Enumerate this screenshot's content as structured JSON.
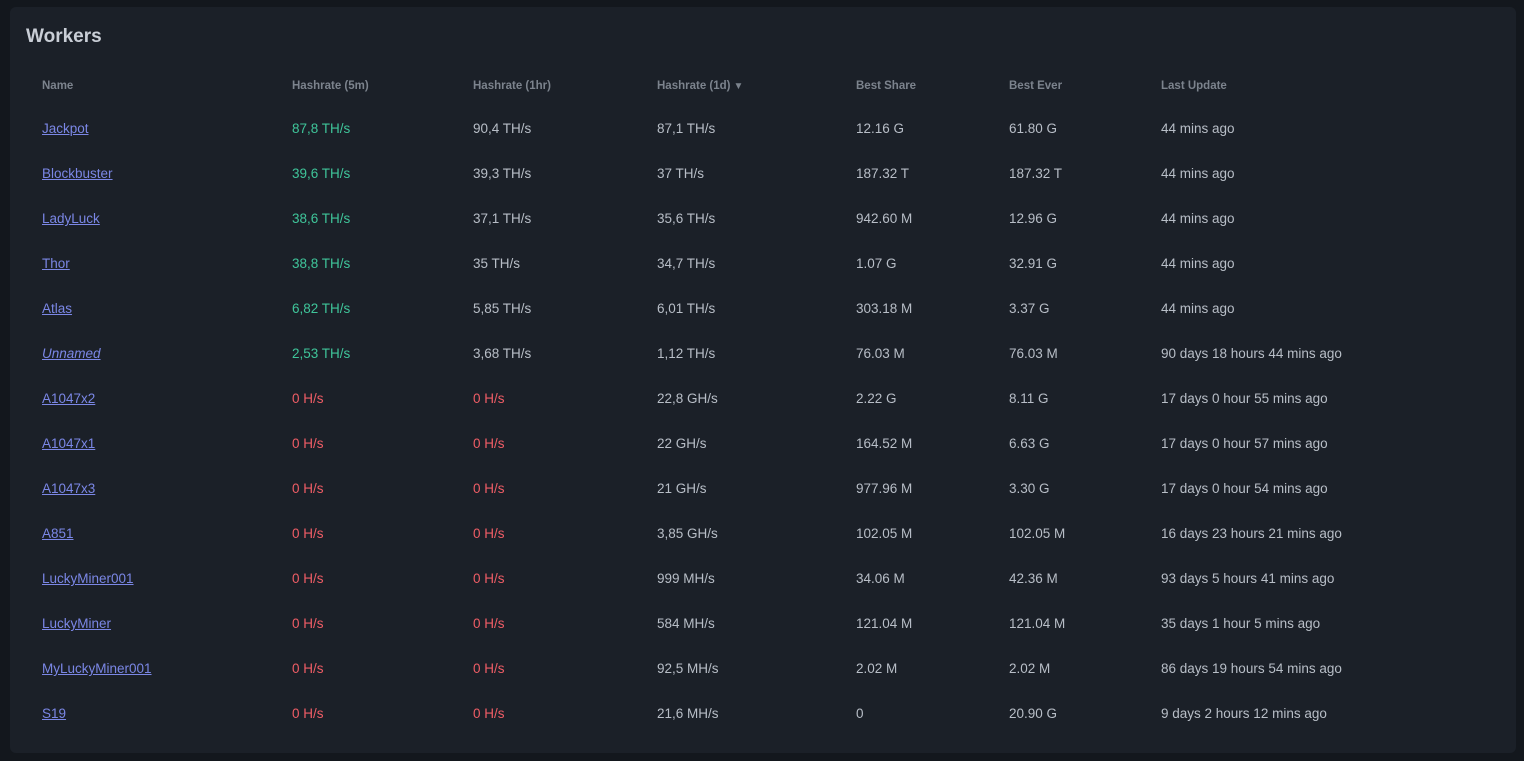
{
  "title": "Workers",
  "columns": {
    "name": "Name",
    "hr5m": "Hashrate (5m)",
    "hr1h": "Hashrate (1hr)",
    "hr1d": "Hashrate (1d)",
    "best_share": "Best Share",
    "best_ever": "Best Ever",
    "last_update": "Last Update"
  },
  "sort_indicator": "▼",
  "colors": {
    "online": "#3fc59a",
    "offline": "#f05d66",
    "link": "#7b87e6"
  },
  "rows": [
    {
      "name": "Jackpot",
      "hr5m": "87,8 TH/s",
      "hr1h": "90,4 TH/s",
      "hr1d": "87,1 TH/s",
      "best_share": "12.16 G",
      "best_ever": "61.80 G",
      "last_update": "44 mins ago",
      "status": "online"
    },
    {
      "name": "Blockbuster",
      "hr5m": "39,6 TH/s",
      "hr1h": "39,3 TH/s",
      "hr1d": "37 TH/s",
      "best_share": "187.32 T",
      "best_ever": "187.32 T",
      "last_update": "44 mins ago",
      "status": "online"
    },
    {
      "name": "LadyLuck",
      "hr5m": "38,6 TH/s",
      "hr1h": "37,1 TH/s",
      "hr1d": "35,6 TH/s",
      "best_share": "942.60 M",
      "best_ever": "12.96 G",
      "last_update": "44 mins ago",
      "status": "online"
    },
    {
      "name": "Thor",
      "hr5m": "38,8 TH/s",
      "hr1h": "35 TH/s",
      "hr1d": "34,7 TH/s",
      "best_share": "1.07 G",
      "best_ever": "32.91 G",
      "last_update": "44 mins ago",
      "status": "online"
    },
    {
      "name": "Atlas",
      "hr5m": "6,82 TH/s",
      "hr1h": "5,85 TH/s",
      "hr1d": "6,01 TH/s",
      "best_share": "303.18 M",
      "best_ever": "3.37 G",
      "last_update": "44 mins ago",
      "status": "online"
    },
    {
      "name": "Unnamed",
      "hr5m": "2,53 TH/s",
      "hr1h": "3,68 TH/s",
      "hr1d": "1,12 TH/s",
      "best_share": "76.03 M",
      "best_ever": "76.03 M",
      "last_update": "90 days 18 hours 44 mins ago",
      "status": "online",
      "italic": true
    },
    {
      "name": "A1047x2",
      "hr5m": "0 H/s",
      "hr1h": "0 H/s",
      "hr1d": "22,8 GH/s",
      "best_share": "2.22 G",
      "best_ever": "8.11 G",
      "last_update": "17 days 0 hour 55 mins ago",
      "status": "offline"
    },
    {
      "name": "A1047x1",
      "hr5m": "0 H/s",
      "hr1h": "0 H/s",
      "hr1d": "22 GH/s",
      "best_share": "164.52 M",
      "best_ever": "6.63 G",
      "last_update": "17 days 0 hour 57 mins ago",
      "status": "offline"
    },
    {
      "name": "A1047x3",
      "hr5m": "0 H/s",
      "hr1h": "0 H/s",
      "hr1d": "21 GH/s",
      "best_share": "977.96 M",
      "best_ever": "3.30 G",
      "last_update": "17 days 0 hour 54 mins ago",
      "status": "offline"
    },
    {
      "name": "A851",
      "hr5m": "0 H/s",
      "hr1h": "0 H/s",
      "hr1d": "3,85 GH/s",
      "best_share": "102.05 M",
      "best_ever": "102.05 M",
      "last_update": "16 days 23 hours 21 mins ago",
      "status": "offline"
    },
    {
      "name": "LuckyMiner001",
      "hr5m": "0 H/s",
      "hr1h": "0 H/s",
      "hr1d": "999 MH/s",
      "best_share": "34.06 M",
      "best_ever": "42.36 M",
      "last_update": "93 days 5 hours 41 mins ago",
      "status": "offline"
    },
    {
      "name": "LuckyMiner",
      "hr5m": "0 H/s",
      "hr1h": "0 H/s",
      "hr1d": "584 MH/s",
      "best_share": "121.04 M",
      "best_ever": "121.04 M",
      "last_update": "35 days 1 hour 5 mins ago",
      "status": "offline"
    },
    {
      "name": "MyLuckyMiner001",
      "hr5m": "0 H/s",
      "hr1h": "0 H/s",
      "hr1d": "92,5 MH/s",
      "best_share": "2.02 M",
      "best_ever": "2.02 M",
      "last_update": "86 days 19 hours 54 mins ago",
      "status": "offline"
    },
    {
      "name": "S19",
      "hr5m": "0 H/s",
      "hr1h": "0 H/s",
      "hr1d": "21,6 MH/s",
      "best_share": "0",
      "best_ever": "20.90 G",
      "last_update": "9 days 2 hours 12 mins ago",
      "status": "offline"
    }
  ]
}
